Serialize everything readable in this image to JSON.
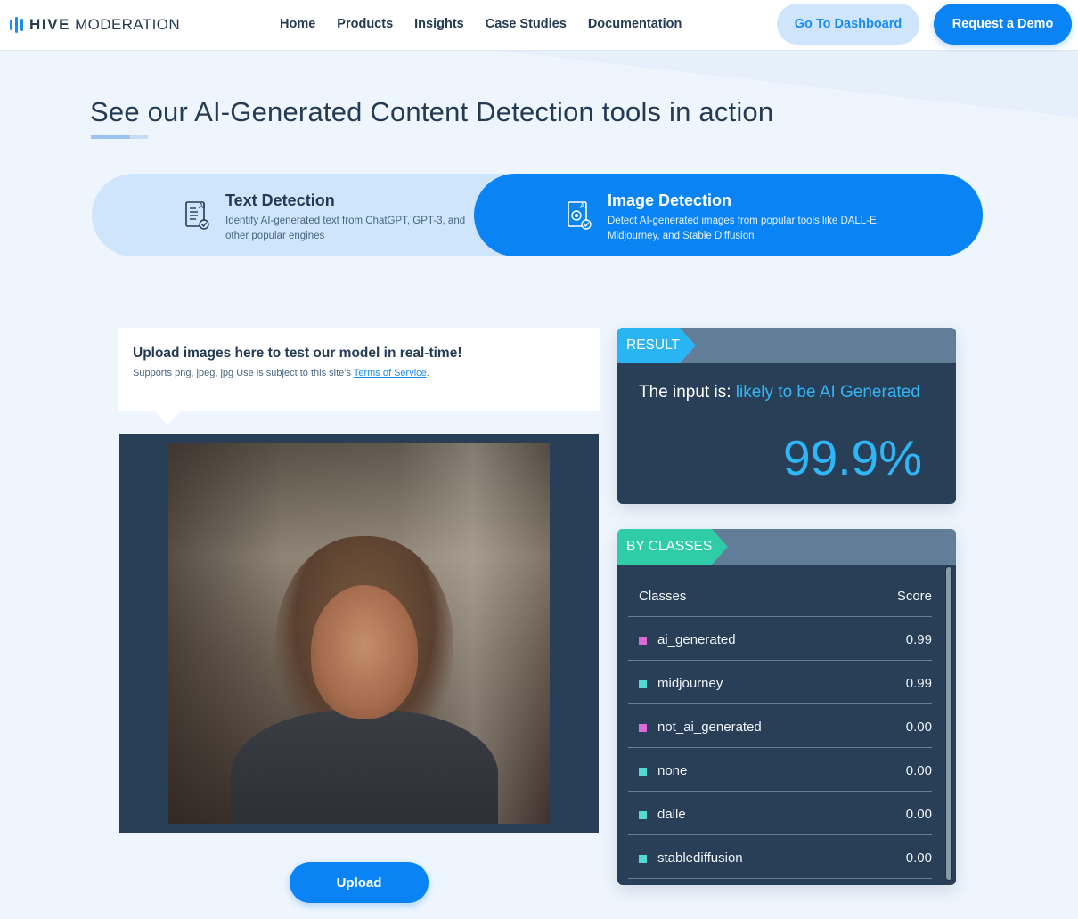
{
  "brand": {
    "name_bold": "HIVE",
    "name_light": "MODERATION"
  },
  "nav": [
    "Home",
    "Products",
    "Insights",
    "Case Studies",
    "Documentation"
  ],
  "header_buttons": {
    "dashboard": "Go To Dashboard",
    "demo": "Request a Demo"
  },
  "headline": "See our AI-Generated Content Detection tools in action",
  "tabs": [
    {
      "title": "Text Detection",
      "description": "Identify AI-generated text from ChatGPT, GPT-3, and other popular engines",
      "icon": "ai-text-document-icon",
      "active": false
    },
    {
      "title": "Image Detection",
      "description": "Detect AI-generated images from popular tools like DALL-E, Midjourney, and Stable Diffusion",
      "icon": "ai-image-document-icon",
      "active": true
    }
  ],
  "upload": {
    "title": "Upload images here to test our model in real-time!",
    "subtitle": "Supports png, jpeg, jpg Use is subject to this site’s ",
    "terms_link": "Terms of Service",
    "terms_suffix": ".",
    "button": "Upload"
  },
  "result": {
    "label": "RESULT",
    "prefix": "The input is: ",
    "verdict": "likely to be AI Generated",
    "percentage": "99.9%"
  },
  "classes": {
    "label": "BY CLASSES",
    "headers": {
      "class": "Classes",
      "score": "Score"
    },
    "rows": [
      {
        "name": "ai_generated",
        "score": "0.99",
        "color": "#d96ad8"
      },
      {
        "name": "midjourney",
        "score": "0.99",
        "color": "#53d9d1"
      },
      {
        "name": "not_ai_generated",
        "score": "0.00",
        "color": "#d96ad8"
      },
      {
        "name": "none",
        "score": "0.00",
        "color": "#53d9d1"
      },
      {
        "name": "dalle",
        "score": "0.00",
        "color": "#53d9d1"
      },
      {
        "name": "stablediffusion",
        "score": "0.00",
        "color": "#53d9d1"
      }
    ]
  },
  "colors": {
    "primary": "#0a84f5",
    "result_accent": "#2bb4f2",
    "classes_accent": "#2ecda7",
    "card_bg": "#283f57"
  }
}
